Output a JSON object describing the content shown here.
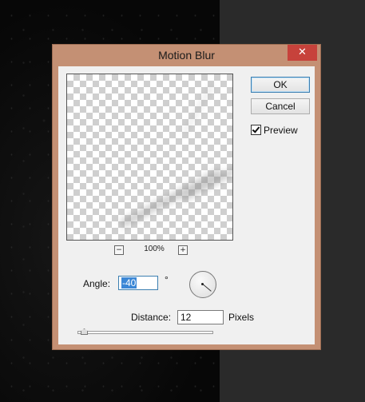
{
  "dialog": {
    "title": "Motion Blur",
    "close_glyph": "✕",
    "ok_label": "OK",
    "cancel_label": "Cancel",
    "preview_label": "Preview",
    "preview_checked": true,
    "zoom": {
      "minus": "−",
      "level": "100%",
      "plus": "+"
    },
    "angle": {
      "label": "Angle:",
      "value": "-40",
      "unit": "°"
    },
    "distance": {
      "label": "Distance:",
      "value": "12",
      "unit": "Pixels"
    },
    "distance_slider_fraction": 0.03
  },
  "colors": {
    "dialog_frame": "#c49074",
    "close_button": "#c7423b",
    "selection": "#3b87d6"
  }
}
